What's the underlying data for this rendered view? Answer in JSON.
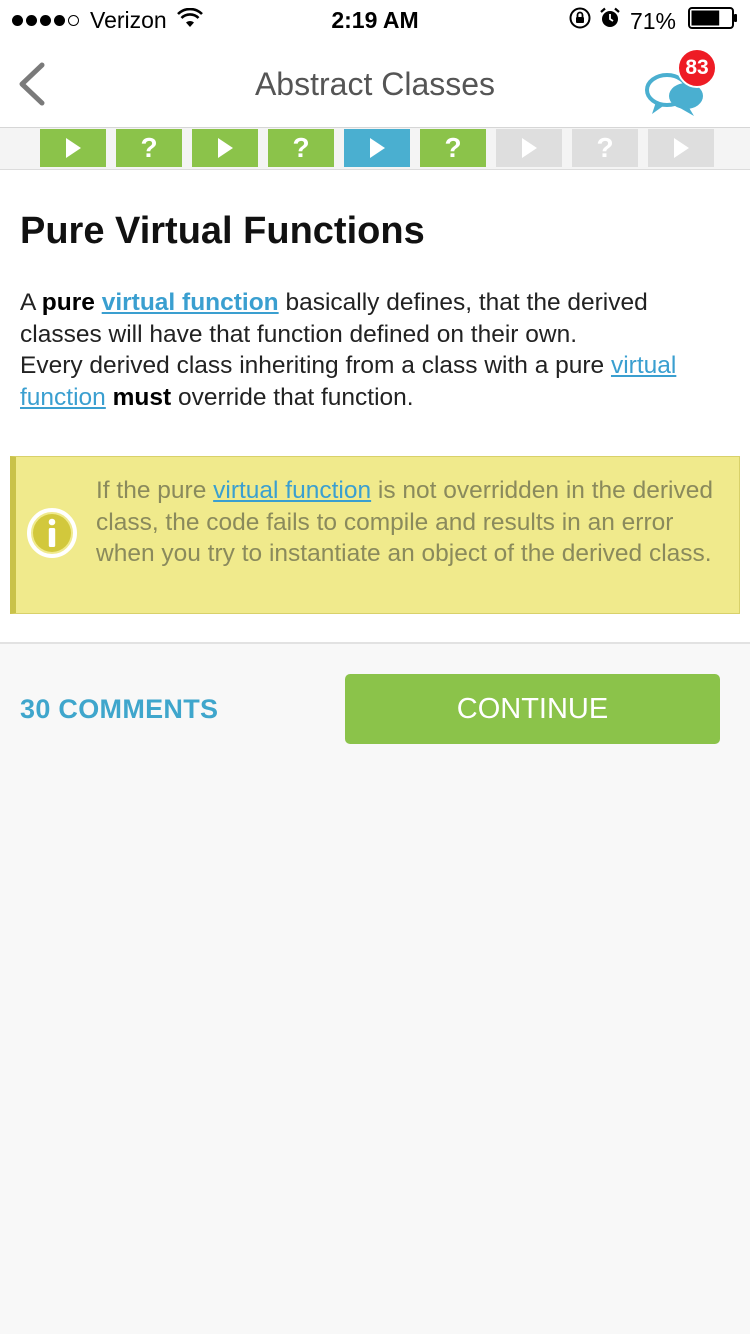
{
  "status_bar": {
    "carrier": "Verizon",
    "time": "2:19 AM",
    "battery": "71%",
    "battery_level": 0.71
  },
  "nav": {
    "title": "Abstract Classes",
    "chat_badge": "83"
  },
  "progress": {
    "steps": [
      {
        "kind": "play",
        "state": "done"
      },
      {
        "kind": "quiz",
        "state": "done"
      },
      {
        "kind": "play",
        "state": "done"
      },
      {
        "kind": "quiz",
        "state": "done"
      },
      {
        "kind": "play",
        "state": "current"
      },
      {
        "kind": "quiz",
        "state": "done"
      },
      {
        "kind": "play",
        "state": "locked"
      },
      {
        "kind": "quiz",
        "state": "locked"
      },
      {
        "kind": "play",
        "state": "locked"
      }
    ],
    "quiz_symbol": "?"
  },
  "lesson": {
    "title": "Pure Virtual Functions",
    "p1_a": "A ",
    "p1_pure": "pure",
    "p1_space": " ",
    "p1_link": "virtual function",
    "p1_rest": " basically defines, that the derived classes will have that function defined on their own.",
    "p2_a": "Every derived class inheriting from a class with a pure ",
    "p2_link": "virtual function",
    "p2_space": " ",
    "p2_must": "must",
    "p2_rest": " override that function."
  },
  "note": {
    "a": "If the pure ",
    "link": "virtual function",
    "rest": " is not overridden in the derived class, the code fails to compile and results in an error when you try to instantiate an object of the derived class."
  },
  "actions": {
    "comments": "30 COMMENTS",
    "continue": "CONTINUE"
  },
  "colors": {
    "done": "#8bc34a",
    "current": "#4aafd0",
    "locked": "#dedede",
    "link": "#3a9fd0",
    "note_bg": "#f0ea8c",
    "badge": "#ee1c25"
  },
  "icons": {
    "back": "chevron-left-icon",
    "chat": "chat-bubbles-icon",
    "note": "info-icon",
    "play": "play-icon",
    "quiz": "question-icon"
  }
}
